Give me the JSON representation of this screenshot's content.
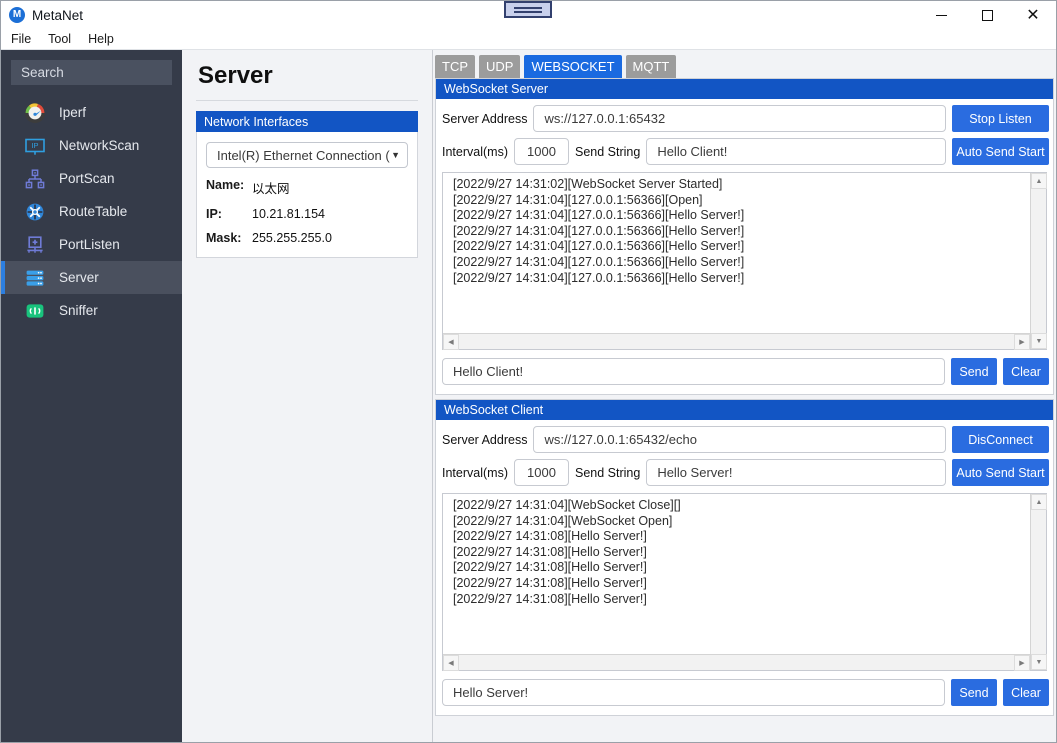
{
  "window": {
    "title": "MetaNet",
    "logo_letter": "M",
    "minimize": "minimize-icon",
    "maximize": "maximize-icon",
    "close": "close-icon"
  },
  "menubar": {
    "items": [
      "File",
      "Tool",
      "Help"
    ]
  },
  "sidebar": {
    "search_placeholder": "Search",
    "items": [
      {
        "label": "Iperf",
        "icon": "gauge-icon",
        "active": false
      },
      {
        "label": "NetworkScan",
        "icon": "ip-icon",
        "active": false
      },
      {
        "label": "PortScan",
        "icon": "network-tree-icon",
        "active": false
      },
      {
        "label": "RouteTable",
        "icon": "route-icon",
        "active": false
      },
      {
        "label": "PortListen",
        "icon": "port-listen-icon",
        "active": false
      },
      {
        "label": "Server",
        "icon": "server-icon",
        "active": true
      },
      {
        "label": "Sniffer",
        "icon": "sniffer-icon",
        "active": false
      }
    ]
  },
  "middle": {
    "page_title": "Server",
    "panel_header": "Network Interfaces",
    "interface_selected": "Intel(R) Ethernet Connection (",
    "caret": "▼",
    "fields": [
      {
        "key": "Name:",
        "value": "以太网"
      },
      {
        "key": "IP:",
        "value": "10.21.81.154"
      },
      {
        "key": "Mask:",
        "value": "255.255.255.0"
      }
    ]
  },
  "tabs": [
    {
      "label": "TCP",
      "active": false
    },
    {
      "label": "UDP",
      "active": false
    },
    {
      "label": "WEBSOCKET",
      "active": true
    },
    {
      "label": "MQTT",
      "active": false
    }
  ],
  "server": {
    "header": "WebSocket Server",
    "address_label": "Server Address",
    "address_value": "ws://127.0.0.1:65432",
    "listen_button": "Stop Listen",
    "interval_label": "Interval(ms)",
    "interval_value": "1000",
    "send_string_label": "Send String",
    "send_string_value": "Hello Client!",
    "auto_send_button": "Auto Send Start",
    "log": [
      "[2022/9/27 14:31:02][WebSocket Server Started]",
      "[2022/9/27 14:31:04][127.0.0.1:56366][Open]",
      "[2022/9/27 14:31:04][127.0.0.1:56366][Hello Server!]",
      "[2022/9/27 14:31:04][127.0.0.1:56366][Hello Server!]",
      "[2022/9/27 14:31:04][127.0.0.1:56366][Hello Server!]",
      "[2022/9/27 14:31:04][127.0.0.1:56366][Hello Server!]",
      "[2022/9/27 14:31:04][127.0.0.1:56366][Hello Server!]"
    ],
    "message_value": "Hello Client!",
    "send_button": "Send",
    "clear_button": "Clear"
  },
  "client": {
    "header": "WebSocket Client",
    "address_label": "Server Address",
    "address_value": "ws://127.0.0.1:65432/echo",
    "connect_button": "DisConnect",
    "interval_label": "Interval(ms)",
    "interval_value": "1000",
    "send_string_label": "Send String",
    "send_string_value": "Hello Server!",
    "auto_send_button": "Auto Send Start",
    "log": [
      "[2022/9/27 14:31:04][WebSocket Close][]",
      "[2022/9/27 14:31:04][WebSocket Open]",
      "[2022/9/27 14:31:08][Hello Server!]",
      "[2022/9/27 14:31:08][Hello Server!]",
      "[2022/9/27 14:31:08][Hello Server!]",
      "[2022/9/27 14:31:08][Hello Server!]",
      "[2022/9/27 14:31:08][Hello Server!]"
    ],
    "message_value": "Hello Server!",
    "send_button": "Send",
    "clear_button": "Clear"
  },
  "scroll": {
    "up": "▲",
    "down": "▼",
    "left": "◀",
    "right": "▶"
  },
  "colors": {
    "accent_blue": "#1255c4",
    "tab_active": "#1a6ae0",
    "button_blue": "#2a6ce0",
    "sidebar_bg": "#353b49",
    "panel_bg": "#f2f3f6"
  }
}
